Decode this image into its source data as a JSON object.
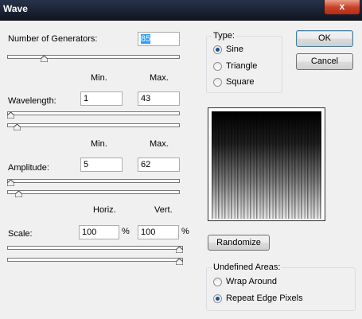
{
  "window": {
    "title": "Wave",
    "close_glyph": "x"
  },
  "generators": {
    "label": "Number of Generators:",
    "value": "85",
    "slider_fraction": 0.2
  },
  "wavelength": {
    "label": "Wavelength:",
    "min_header": "Min.",
    "max_header": "Max.",
    "min": "1",
    "max": "43",
    "min_slider_fraction": 0.0,
    "max_slider_fraction": 0.04
  },
  "amplitude": {
    "label": "Amplitude:",
    "min_header": "Min.",
    "max_header": "Max.",
    "min": "5",
    "max": "62",
    "min_slider_fraction": 0.0,
    "max_slider_fraction": 0.05
  },
  "scale": {
    "label": "Scale:",
    "horiz_header": "Horiz.",
    "vert_header": "Vert.",
    "horiz": "100",
    "vert": "100",
    "unit": "%",
    "horiz_slider_fraction": 1.0,
    "vert_slider_fraction": 1.0
  },
  "type_group": {
    "title": "Type:",
    "options": [
      "Sine",
      "Triangle",
      "Square"
    ],
    "selected": "Sine"
  },
  "buttons": {
    "ok": "OK",
    "cancel": "Cancel",
    "randomize": "Randomize"
  },
  "undefined_areas": {
    "title": "Undefined Areas:",
    "options": [
      "Wrap Around",
      "Repeat Edge Pixels"
    ],
    "selected": "Repeat Edge Pixels"
  },
  "colors": {
    "title_bar": "#1a2233",
    "close_button": "#c7442b",
    "selection": "#3399ff",
    "radio_dot": "#1a4f9c"
  }
}
